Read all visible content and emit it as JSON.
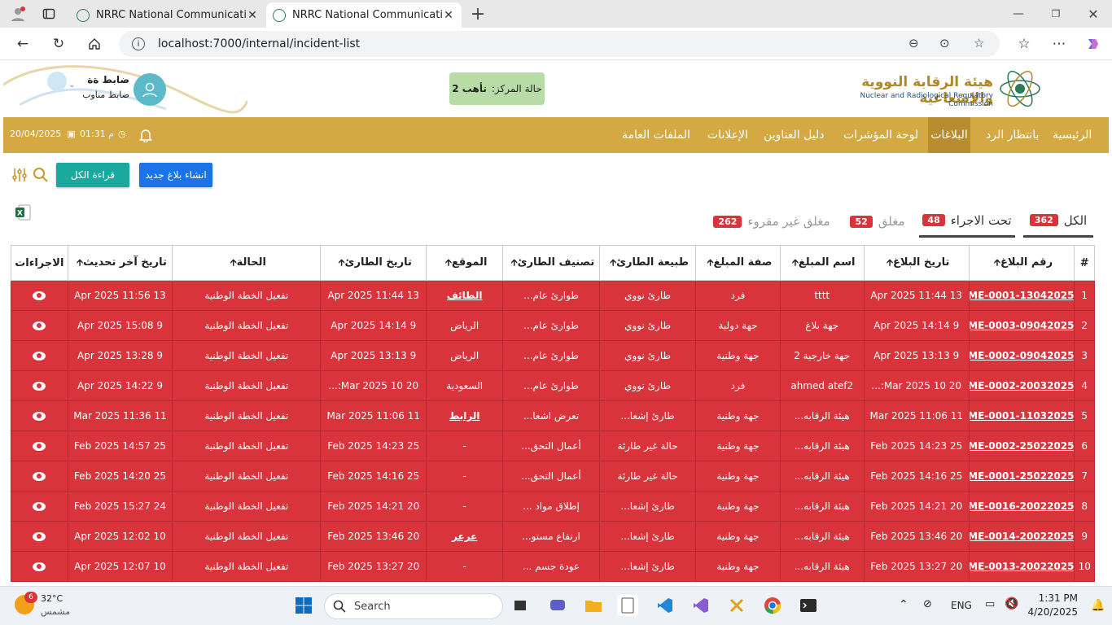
{
  "browser": {
    "tabs": [
      {
        "title": "NRRC National Communication Pl"
      },
      {
        "title": "NRRC National Communication Pl"
      }
    ],
    "url": "localhost:7000/internal/incident-list"
  },
  "header": {
    "org_name_ar": "هيئة الرقابة النووية والإشعاعية",
    "org_name_en": "Nuclear and Radiological Regulatory Commission",
    "center_status_label": "حالة المركز:",
    "center_status_value": "تأهب 2",
    "user_name": "ضابط ةة",
    "user_role": "ضابط مناوب"
  },
  "nav": {
    "items": [
      "الرئيسية",
      "بانتظار الرد",
      "البلاغات",
      "لوحة المؤشرات",
      "دليل العناوين",
      "الإعلانات",
      "الملفات العامة"
    ],
    "active_index": 2,
    "time": "01:31 م",
    "date": "20/04/2025"
  },
  "toolbar": {
    "new_report": "انشاء بلاغ جديد",
    "read_all": "قراءة الكل"
  },
  "status_tabs": [
    {
      "label": "الكل",
      "count": "362"
    },
    {
      "label": "تحت الاجراء",
      "count": "48"
    },
    {
      "label": "مغلق",
      "count": "52"
    },
    {
      "label": "مغلق غير مقروء",
      "count": "262"
    }
  ],
  "table": {
    "headers": [
      "#",
      "رقم البلاغ",
      "تاريخ البلاغ",
      "اسم المبلغ",
      "صفة المبلغ",
      "طبيعة الطارئ",
      "تصنيف الطارئ",
      "الموقع",
      "تاريخ الطارئ",
      "الحالة",
      "تاريخ آخر تحديث",
      "الاجراءات"
    ],
    "rows": [
      [
        "1",
        "EME-0001-13042025",
        "13 Apr 2025 11:44",
        "tttt",
        "فرد",
        "طارئ نووي",
        "طوارئ عام...",
        "الطائف",
        "13 Apr 2025 11:44",
        "تفعيل الخطة الوطنية",
        "13 Apr 2025 11:56"
      ],
      [
        "2",
        "EME-0003-09042025",
        "9 Apr 2025 14:14",
        "جهة بلاغ",
        "جهة دولية",
        "طارئ نووي",
        "طوارئ عام...",
        "الرياض",
        "9 Apr 2025 14:14",
        "تفعيل الخطة الوطنية",
        "9 Apr 2025 15:08"
      ],
      [
        "3",
        "EME-0002-09042025",
        "9 Apr 2025 13:13",
        "جهة خارجية 2",
        "جهة وطنية",
        "طارئ نووي",
        "طوارئ عام...",
        "الرياض",
        "9 Apr 2025 13:13",
        "تفعيل الخطة الوطنية",
        "9 Apr 2025 13:28"
      ],
      [
        "4",
        "EME-0002-20032025",
        "20 Mar 2025 10:...",
        "ahmed atef2",
        "فرد",
        "طارئ نووي",
        "طوارئ عام...",
        "السعودية",
        "20 Mar 2025 10:...",
        "تفعيل الخطة الوطنية",
        "9 Apr 2025 14:22"
      ],
      [
        "5",
        "EME-0001-11032025",
        "11 Mar 2025 11:06",
        "هيئة الرقابه...",
        "جهة وطنية",
        "طارئ إشعا...",
        "تعرض اشعا...",
        "الرابط",
        "11 Mar 2025 11:06",
        "تفعيل الخطة الوطنية",
        "11 Mar 2025 11:36"
      ],
      [
        "6",
        "EME-0002-25022025",
        "25 Feb 2025 14:23",
        "هيئة الرقابه...",
        "جهة وطنية",
        "حالة غير طارئة",
        "أعمال التحق...",
        "-",
        "25 Feb 2025 14:23",
        "تفعيل الخطة الوطنية",
        "25 Feb 2025 14:57"
      ],
      [
        "7",
        "EME-0001-25022025",
        "25 Feb 2025 14:16",
        "هيئة الرقابه...",
        "جهة وطنية",
        "حالة غير طارئة",
        "أعمال التحق...",
        "-",
        "25 Feb 2025 14:16",
        "تفعيل الخطة الوطنية",
        "25 Feb 2025 14:20"
      ],
      [
        "8",
        "EME-0016-20022025",
        "20 Feb 2025 14:21",
        "هيئة الرقابه...",
        "جهة وطنية",
        "طارئ إشعا...",
        "إطلاق مواد ...",
        "-",
        "20 Feb 2025 14:21",
        "تفعيل الخطة الوطنية",
        "24 Feb 2025 15:27"
      ],
      [
        "9",
        "EME-0014-20022025",
        "20 Feb 2025 13:46",
        "هيئة الرقابه...",
        "جهة وطنية",
        "طارئ إشعا...",
        "ارتفاع مستو...",
        "عرعر",
        "20 Feb 2025 13:46",
        "تفعيل الخطة الوطنية",
        "10 Apr 2025 12:02"
      ],
      [
        "10",
        "EME-0013-20022025",
        "20 Feb 2025 13:27",
        "هيئة الرقابه...",
        "جهة وطنية",
        "طارئ إشعا...",
        "عودة جسم ...",
        "-",
        "20 Feb 2025 13:27",
        "تفعيل الخطة الوطنية",
        "10 Apr 2025 12:07"
      ]
    ]
  },
  "taskbar": {
    "temp": "32°C",
    "weather": "مشمس",
    "badge": "6",
    "search": "Search",
    "lang": "ENG",
    "time": "1:31 PM",
    "date": "4/20/2025"
  }
}
